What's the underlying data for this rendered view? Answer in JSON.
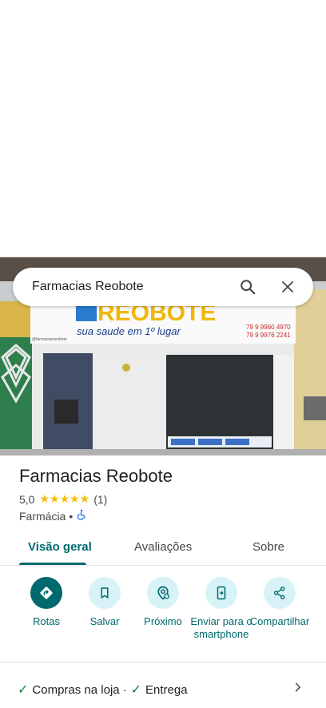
{
  "search": {
    "query": "Farmacias Reobote"
  },
  "photo": {
    "sign_text": "REOBOTE",
    "sign_slogan": "sua saude em 1º lugar",
    "sign_phone_1": "79 9 9960 4970",
    "sign_phone_2": "79 9 9976 2241",
    "sign_handle": "@farmaciasreobote"
  },
  "place": {
    "name": "Farmacias Reobote",
    "rating": "5,0",
    "stars": "★★★★★",
    "review_count": "(1)",
    "category": "Farmácia",
    "separator": "•"
  },
  "tabs": [
    {
      "label": "Visão geral",
      "active": true
    },
    {
      "label": "Avaliações",
      "active": false
    },
    {
      "label": "Sobre",
      "active": false
    }
  ],
  "actions": [
    {
      "label": "Rotas",
      "icon": "directions-icon"
    },
    {
      "label": "Salvar",
      "icon": "bookmark-icon"
    },
    {
      "label": "Próximo",
      "icon": "nearby-icon"
    },
    {
      "label": "Enviar para o smartphone",
      "icon": "send-to-phone-icon"
    },
    {
      "label": "Compartilhar",
      "icon": "share-icon"
    }
  ],
  "services": {
    "item_1": "Compras na loja",
    "separator": "·",
    "item_2": "Entrega"
  },
  "colors": {
    "accent": "#00696e",
    "accent_light": "#d7f3f7",
    "star": "#fbbc04",
    "check": "#188038"
  }
}
